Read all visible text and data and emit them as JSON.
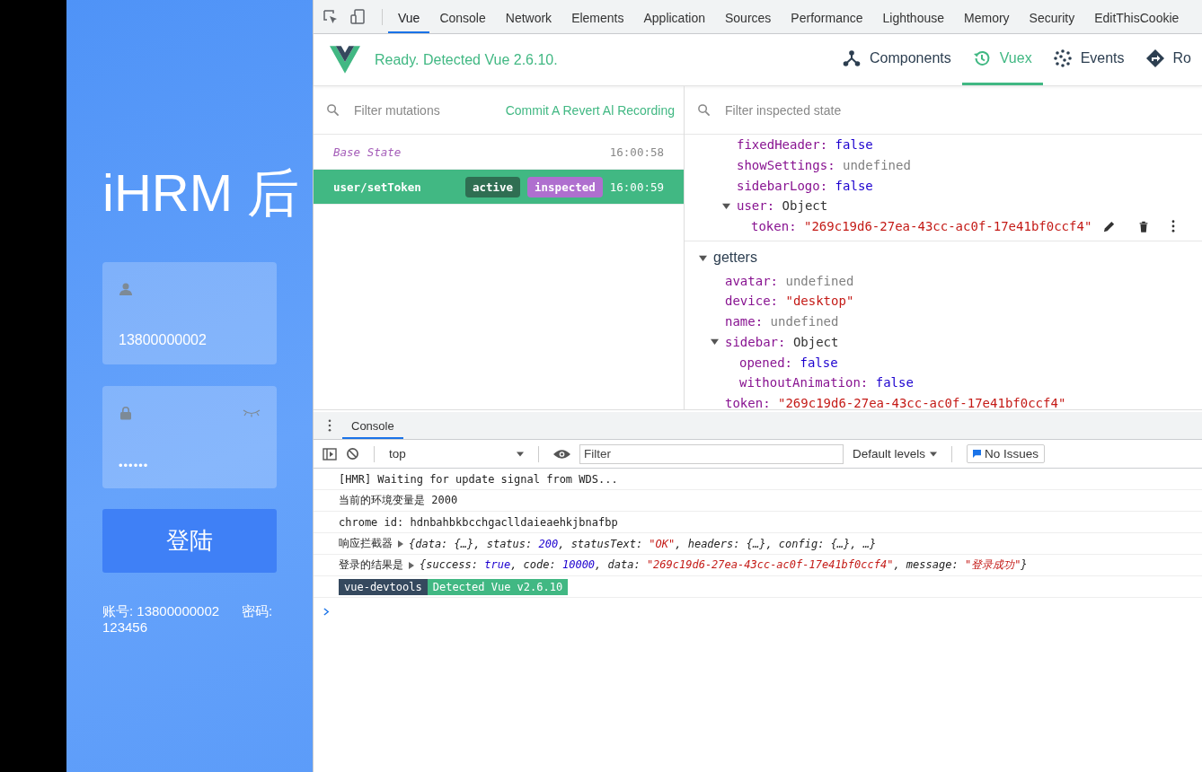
{
  "login": {
    "title": "iHRM 后",
    "username": {
      "value": "13800000002"
    },
    "password": {
      "value": "••••••"
    },
    "submit": "登陆",
    "hint": "账号: 13800000002      密码: 123456"
  },
  "devtools": {
    "tabs": [
      {
        "label": "Vue",
        "selected": true
      },
      {
        "label": "Console",
        "selected": false
      },
      {
        "label": "Network",
        "selected": false
      },
      {
        "label": "Elements",
        "selected": false
      },
      {
        "label": "Application",
        "selected": false
      },
      {
        "label": "Sources",
        "selected": false
      },
      {
        "label": "Performance",
        "selected": false
      },
      {
        "label": "Lighthouse",
        "selected": false
      },
      {
        "label": "Memory",
        "selected": false
      },
      {
        "label": "Security",
        "selected": false
      },
      {
        "label": "EditThisCookie",
        "selected": false
      }
    ],
    "vue": {
      "status": "Ready. Detected Vue 2.6.10.",
      "tabs": [
        {
          "label": "Components",
          "kind": "components",
          "selected": false
        },
        {
          "label": "Vuex",
          "kind": "vuex",
          "selected": true
        },
        {
          "label": "Events",
          "kind": "events",
          "selected": false
        },
        {
          "label": "Ro",
          "kind": "router",
          "selected": false
        }
      ],
      "mutation_filter": {
        "placeholder": "Filter mutations"
      },
      "mutation_actions": "Commit A Revert Al Recording",
      "state_filter": {
        "placeholder": "Filter inspected state"
      },
      "mutations": [
        {
          "name": "Base State",
          "time": "16:00:58",
          "selected": false
        },
        {
          "name": "user/setToken",
          "time": "16:00:59",
          "selected": true,
          "badges": [
            {
              "text": "active",
              "kind": "active"
            },
            {
              "text": "inspected",
              "kind": "inspected"
            }
          ]
        }
      ],
      "state": [
        {
          "key": "fixedHeader:",
          "value": "false",
          "kind": "boolean"
        },
        {
          "key": "showSettings:",
          "value": "undefined",
          "kind": "undefined"
        },
        {
          "key": "sidebarLogo:",
          "value": "false",
          "kind": "boolean"
        },
        {
          "key": "user:",
          "value": "Object",
          "kind": "object",
          "expanded": true,
          "children": [
            {
              "key": "token:",
              "value": "\"269c19d6-27ea-43cc-ac0f-17e41bf0ccf4\"",
              "kind": "string",
              "hovered": true
            }
          ]
        }
      ],
      "getters": {
        "title": "getters",
        "expanded": true,
        "children": [
          {
            "key": "avatar:",
            "value": "undefined",
            "kind": "undefined"
          },
          {
            "key": "device:",
            "value": "\"desktop\"",
            "kind": "string"
          },
          {
            "key": "name:",
            "value": "undefined",
            "kind": "undefined"
          },
          {
            "key": "sidebar:",
            "value": "Object",
            "kind": "object",
            "expanded": true,
            "children": [
              {
                "key": "opened:",
                "value": "false",
                "kind": "boolean"
              },
              {
                "key": "withoutAnimation:",
                "value": "false",
                "kind": "boolean"
              }
            ]
          },
          {
            "key": "token:",
            "value": "\"269c19d6-27ea-43cc-ac0f-17e41bf0ccf4\"",
            "kind": "string"
          }
        ]
      }
    },
    "console": {
      "tab": "Console",
      "context": "top",
      "filter": {
        "placeholder": "Filter"
      },
      "levels": "Default levels",
      "issues": "No Issues",
      "lines": [
        {
          "kind": "text",
          "text": "[HMR] Waiting for update signal from WDS..."
        },
        {
          "kind": "text",
          "text": "当前的环境变量是 2000"
        },
        {
          "kind": "text",
          "text": "chrome id: hdnbahbkbcchgaclldaieaehkjbnafbp"
        },
        {
          "kind": "object",
          "label": "响应拦截器",
          "segments": [
            {
              "text": "{data: {…}, status: ",
              "kind": "plain"
            },
            {
              "text": "200",
              "kind": "number"
            },
            {
              "text": ", statusText: ",
              "kind": "plain"
            },
            {
              "text": "\"OK\"",
              "kind": "string"
            },
            {
              "text": ", headers: {…}, config: {…}, …}",
              "kind": "plain"
            }
          ]
        },
        {
          "kind": "object",
          "label": "登录的结果是",
          "segments": [
            {
              "text": "{success: ",
              "kind": "plain"
            },
            {
              "text": "true",
              "kind": "number"
            },
            {
              "text": ", code: ",
              "kind": "plain"
            },
            {
              "text": "10000",
              "kind": "number"
            },
            {
              "text": ", data: ",
              "kind": "plain"
            },
            {
              "text": "\"269c19d6-27ea-43cc-ac0f-17e41bf0ccf4\"",
              "kind": "string"
            },
            {
              "text": ", message: ",
              "kind": "plain"
            },
            {
              "text": "\"登录成功\"",
              "kind": "string"
            },
            {
              "text": "}",
              "kind": "plain"
            }
          ]
        },
        {
          "kind": "badges",
          "badges": [
            {
              "text": "vue-devtools",
              "color": "#35495e"
            },
            {
              "text": "Detected Vue v2.6.10",
              "color": "#41b883"
            }
          ]
        }
      ]
    }
  }
}
